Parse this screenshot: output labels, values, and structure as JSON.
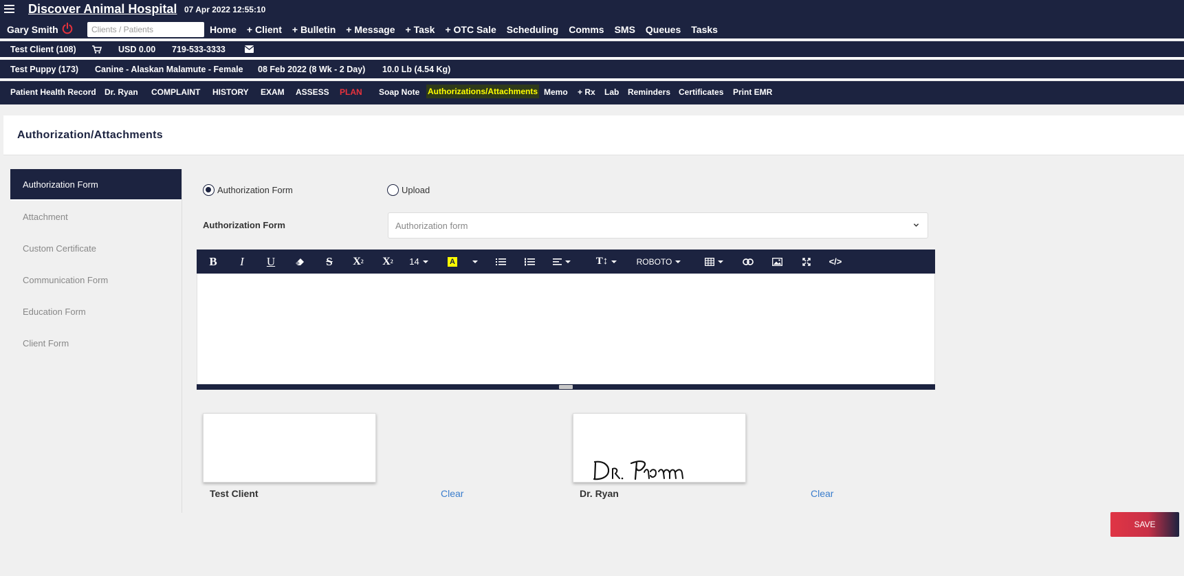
{
  "header": {
    "hospital_name": "Discover Animal Hospital",
    "datetime": "07 Apr 2022 12:55:10",
    "user": "Gary Smith",
    "search_placeholder": "Clients / Patients",
    "nav": [
      "Home",
      "+ Client",
      "+ Bulletin",
      "+ Message",
      "+ Task",
      "+ OTC Sale",
      "Scheduling",
      "Comms",
      "SMS",
      "Queues",
      "Tasks"
    ]
  },
  "client_bar": {
    "client": "Test Client (108)",
    "balance": "USD 0.00",
    "phone": "719-533-3333"
  },
  "patient_bar": {
    "patient": "Test Puppy (173)",
    "species": "Canine - Alaskan Malamute - Female",
    "dob": "08 Feb 2022 (8 Wk - 2 Day)",
    "weight": "10.0 Lb (4.54 Kg)"
  },
  "ehr_bar": {
    "title": "Patient Health Record",
    "doctor": "Dr. Ryan",
    "tabs": [
      "COMPLAINT",
      "HISTORY",
      "EXAM",
      "ASSESS",
      "PLAN",
      "Soap Note",
      "Authorizations/Attachments",
      "Memo",
      "+ Rx",
      "Lab",
      "Reminders",
      "Certificates",
      "Print EMR"
    ]
  },
  "page": {
    "title": "Authorization/Attachments"
  },
  "sidebar": {
    "items": [
      "Authorization Form",
      "Attachment",
      "Custom Certificate",
      "Communication Form",
      "Education Form",
      "Client Form"
    ]
  },
  "form": {
    "radio_auth": "Authorization Form",
    "radio_upload": "Upload",
    "field_label": "Authorization Form",
    "select_placeholder": "Authorization form"
  },
  "toolbar": {
    "font_size": "14",
    "font_family": "ROBOTO"
  },
  "signatures": {
    "client_name": "Test Client",
    "doctor_name": "Dr. Ryan",
    "clear_label": "Clear"
  },
  "save_label": "SAVE",
  "colors": {
    "navy": "#1c2340",
    "active_tab_highlight": "#ffff00",
    "plan_red": "#e8323c",
    "link_blue": "#3a7dcc"
  }
}
